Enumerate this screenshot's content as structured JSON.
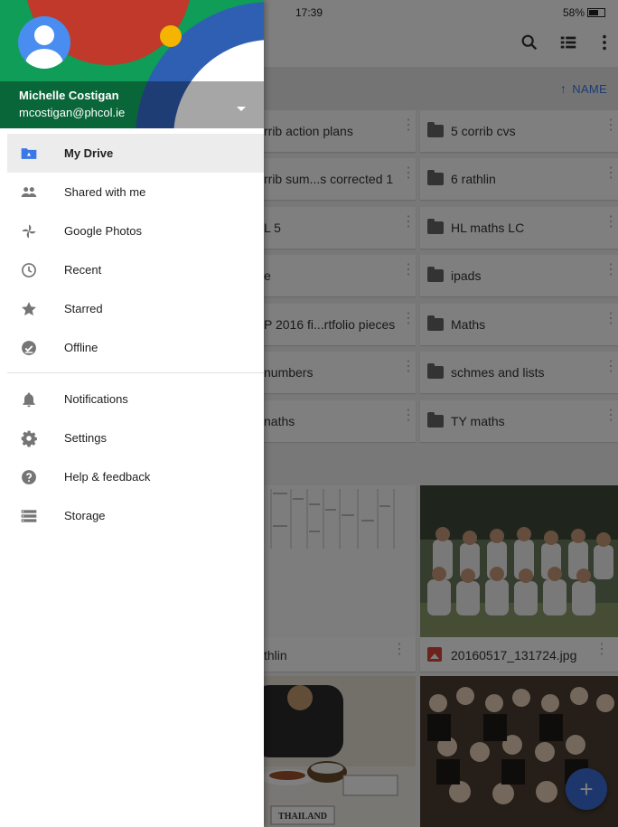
{
  "status_bar": {
    "time": "17:39",
    "battery": "58%"
  },
  "sort": {
    "label": "NAME"
  },
  "folders": {
    "left": [
      "rrib action plans",
      "rrib sum...s corrected 1",
      "L 5",
      "e",
      "P 2016 fi...rtfolio pieces",
      "numbers",
      "naths"
    ],
    "right": [
      "5 corrib cvs",
      "6 rathlin",
      "HL maths LC",
      "ipads",
      "Maths",
      "schmes and lists",
      "TY maths"
    ]
  },
  "files": {
    "left_name": "thlin",
    "right_name": "20160517_131724.jpg",
    "bottom_left_caption": "THAILAND"
  },
  "account": {
    "name": "Michelle Costigan",
    "email": "mcostigan@phcol.ie"
  },
  "nav": {
    "primary": [
      {
        "label": "My Drive",
        "icon": "drive-folder-icon"
      },
      {
        "label": "Shared with me",
        "icon": "people-icon"
      },
      {
        "label": "Google Photos",
        "icon": "pinwheel-icon"
      },
      {
        "label": "Recent",
        "icon": "clock-icon"
      },
      {
        "label": "Starred",
        "icon": "star-icon"
      },
      {
        "label": "Offline",
        "icon": "offline-check-icon"
      }
    ],
    "secondary": [
      {
        "label": "Notifications",
        "icon": "bell-icon"
      },
      {
        "label": "Settings",
        "icon": "gear-icon"
      },
      {
        "label": "Help & feedback",
        "icon": "help-icon"
      },
      {
        "label": "Storage",
        "icon": "storage-icon"
      }
    ]
  },
  "colors": {
    "accent": "#3b78e7",
    "fab": "#3b6fd8",
    "header_green": "#0f9d58",
    "header_red": "#c0392b",
    "header_blue": "#2f5fb3",
    "header_yellow": "#f4b400"
  }
}
